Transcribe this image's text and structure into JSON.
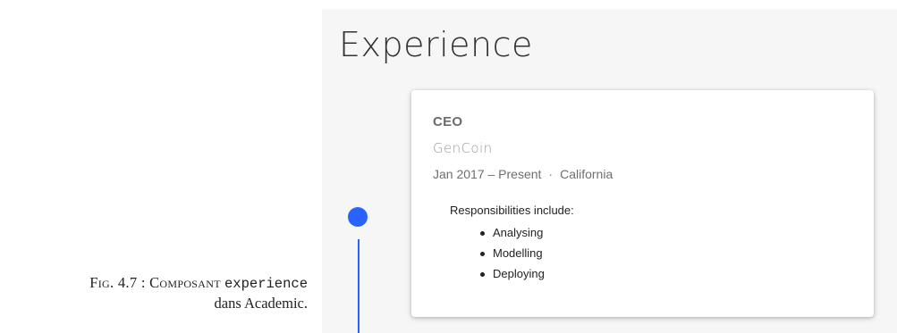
{
  "caption": {
    "prefix": "Fig. 4.7 : Composant",
    "code": "experience",
    "suffix": "dans Academic."
  },
  "section": {
    "title": "Experience"
  },
  "experience": [
    {
      "title": "CEO",
      "company": "GenCoin",
      "date_range": "Jan 2017 – Present",
      "separator": "·",
      "location": "California",
      "description_intro": "Responsibilities include:",
      "responsibilities": [
        "Analysing",
        "Modelling",
        "Deploying"
      ]
    }
  ],
  "colors": {
    "accent": "#2962ff",
    "panel_bg": "#f6f6f6",
    "card_bg": "#ffffff"
  }
}
